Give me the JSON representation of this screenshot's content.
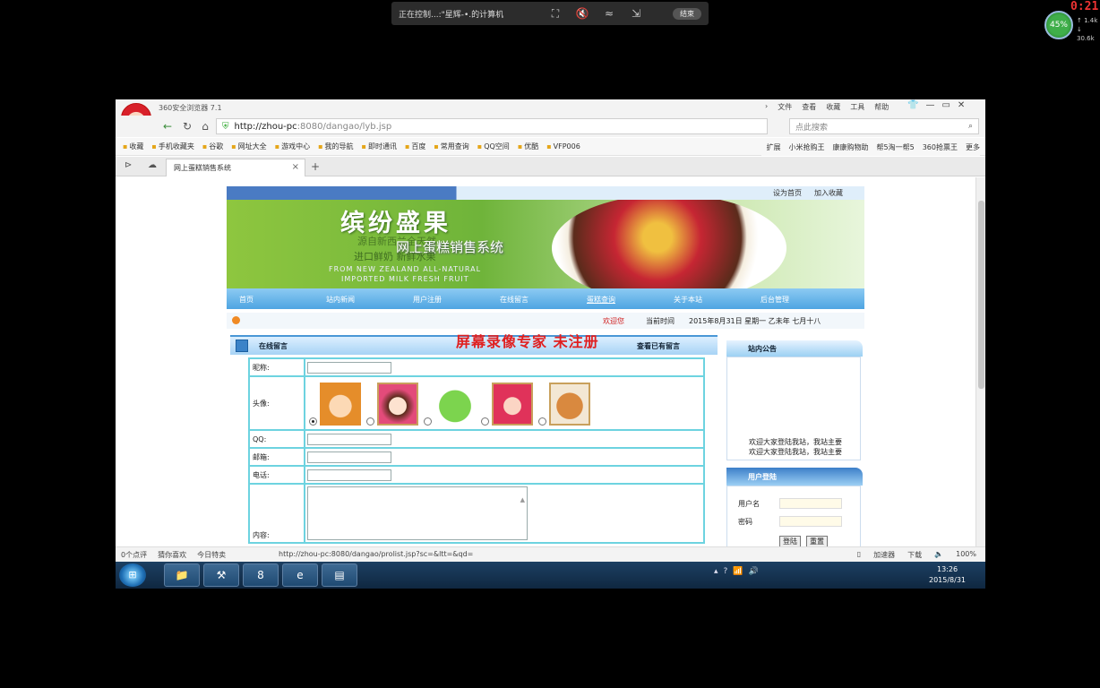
{
  "remote_bar": {
    "text": "正在控制...:\"星辉-•.的计算机",
    "end_label": "结束",
    "icons": [
      "screen-icon",
      "mute-icon",
      "network-icon",
      "pin-icon"
    ]
  },
  "recording_time": "0:21",
  "net_widget": {
    "percent": "45%",
    "up": "1.4k",
    "down": "30.6k"
  },
  "browser": {
    "title": "360安全浏览器 7.1",
    "menu": [
      "文件",
      "查看",
      "收藏",
      "工具",
      "帮助"
    ],
    "url_host": "http://zhou-pc",
    "url_rest": ":8080/dangao/lyb.jsp",
    "search_placeholder": "点此搜索",
    "bookmarks": [
      "收藏",
      "手机收藏夹",
      "谷歌",
      "网址大全",
      "游戏中心",
      "我的导航",
      "即时通讯",
      "百度",
      "常用查询",
      "QQ空间",
      "优酷",
      "VFP006"
    ],
    "bookmarks_right": [
      "扩展",
      "小米抢购王",
      "康康购物助",
      "帮5淘一帮5",
      "360抢票王",
      "更多"
    ],
    "tab_title": "网上蛋糕销售系统"
  },
  "site": {
    "top_links": [
      "设为首页",
      "加入收藏"
    ],
    "banner_title": "缤纷盛果",
    "banner_system": "网上蛋糕销售系统",
    "banner_sub1": "源自新西兰全天然",
    "banner_sub2": "进口鲜奶 新鲜水果",
    "banner_en1": "FROM NEW ZEALAND ALL-NATURAL",
    "banner_en2": "IMPORTED MILK FRESH FRUIT",
    "nav": [
      "首页",
      "站内新闻",
      "用户注册",
      "在线留言",
      "蛋糕查询",
      "关于本站",
      "后台管理"
    ],
    "welcome": "欢迎您",
    "now_label": "当前时间",
    "date": "2015年8月31日 星期一 乙未年 七月十八",
    "watermark": "屏幕录像专家  未注册",
    "message": {
      "title": "在线留言",
      "view_link": "查看已有留言",
      "nickname_label": "昵称:",
      "avatar_label": "头像:",
      "qq_label": "QQ:",
      "email_label": "邮箱:",
      "phone_label": "电话:",
      "content_label": "内容:"
    },
    "notice": {
      "title": "站内公告",
      "line1": "欢迎大家登陆我站，我站主要",
      "line2": "欢迎大家登陆我站，我站主要"
    },
    "login": {
      "title": "用户登陆",
      "user_label": "用户名",
      "pass_label": "密码",
      "login_btn": "登陆",
      "reset_btn": "重置"
    }
  },
  "statusbar": {
    "left": [
      "0个点评",
      "猜你喜欢",
      "今日特卖"
    ],
    "url": "http://zhou-pc:8080/dangao/prolist.jsp?sc=&ltt=&qd=",
    "accelerator": "加速器",
    "download": "下载",
    "zoom": "100%"
  },
  "taskbar": {
    "time": "13:26",
    "date": "2015/8/31"
  }
}
